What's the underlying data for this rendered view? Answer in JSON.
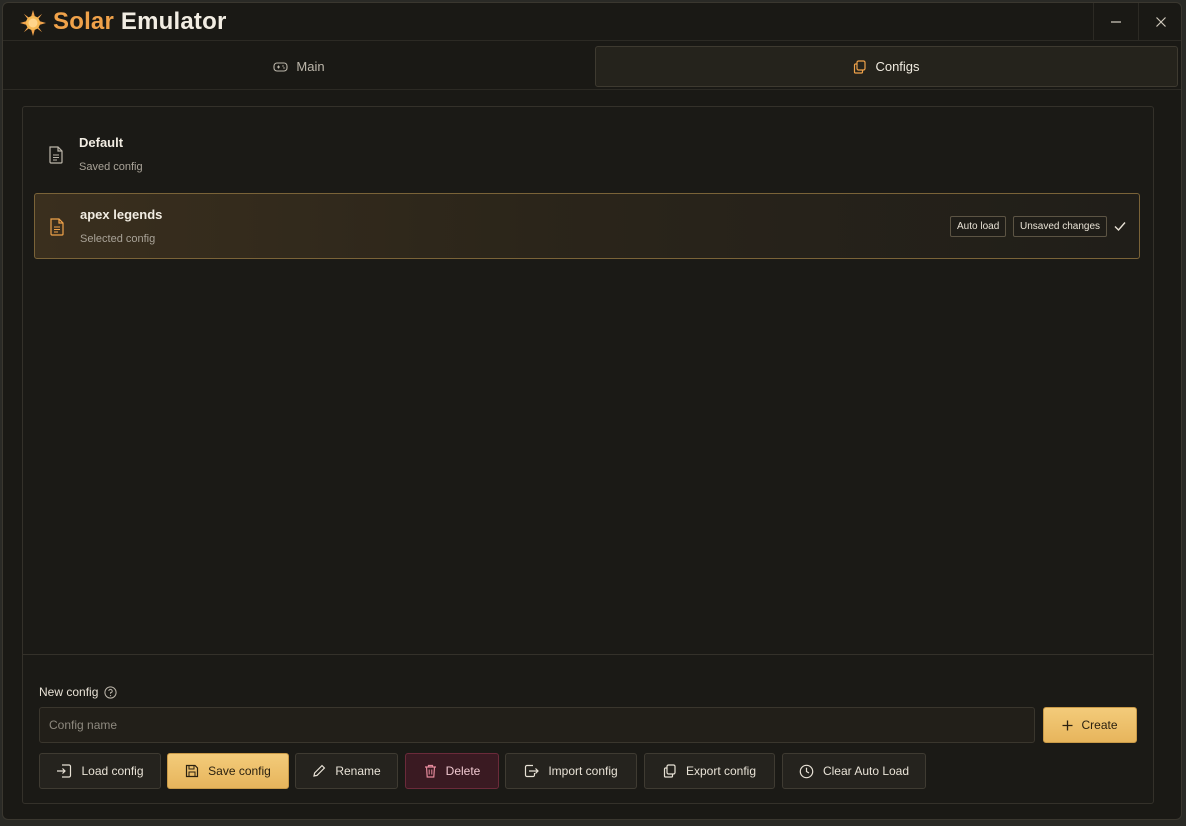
{
  "app": {
    "title_accent": "Solar",
    "title_rest": "Emulator"
  },
  "window_controls": {
    "minimize_icon": "minimize-icon",
    "close_icon": "close-icon"
  },
  "tabs": [
    {
      "label": "Main",
      "icon": "gamepad-icon",
      "active": false
    },
    {
      "label": "Configs",
      "icon": "copy-icon",
      "active": true
    }
  ],
  "configs": [
    {
      "name": "Default",
      "subtitle": "Saved config",
      "selected": false
    },
    {
      "name": "apex legends",
      "subtitle": "Selected config",
      "selected": true,
      "badges": [
        "Auto load",
        "Unsaved changes"
      ]
    }
  ],
  "new_config": {
    "label": "New config",
    "placeholder": "Config name",
    "value": "",
    "create_label": "Create"
  },
  "actions": {
    "load": "Load config",
    "save": "Save config",
    "rename": "Rename",
    "delete": "Delete",
    "import": "Import config",
    "export": "Export config",
    "clear": "Clear Auto Load"
  },
  "colors": {
    "accent": "#f0a24a",
    "primary_button": "#eebf6a",
    "danger": "#3a1a22",
    "background": "#1a1915"
  }
}
